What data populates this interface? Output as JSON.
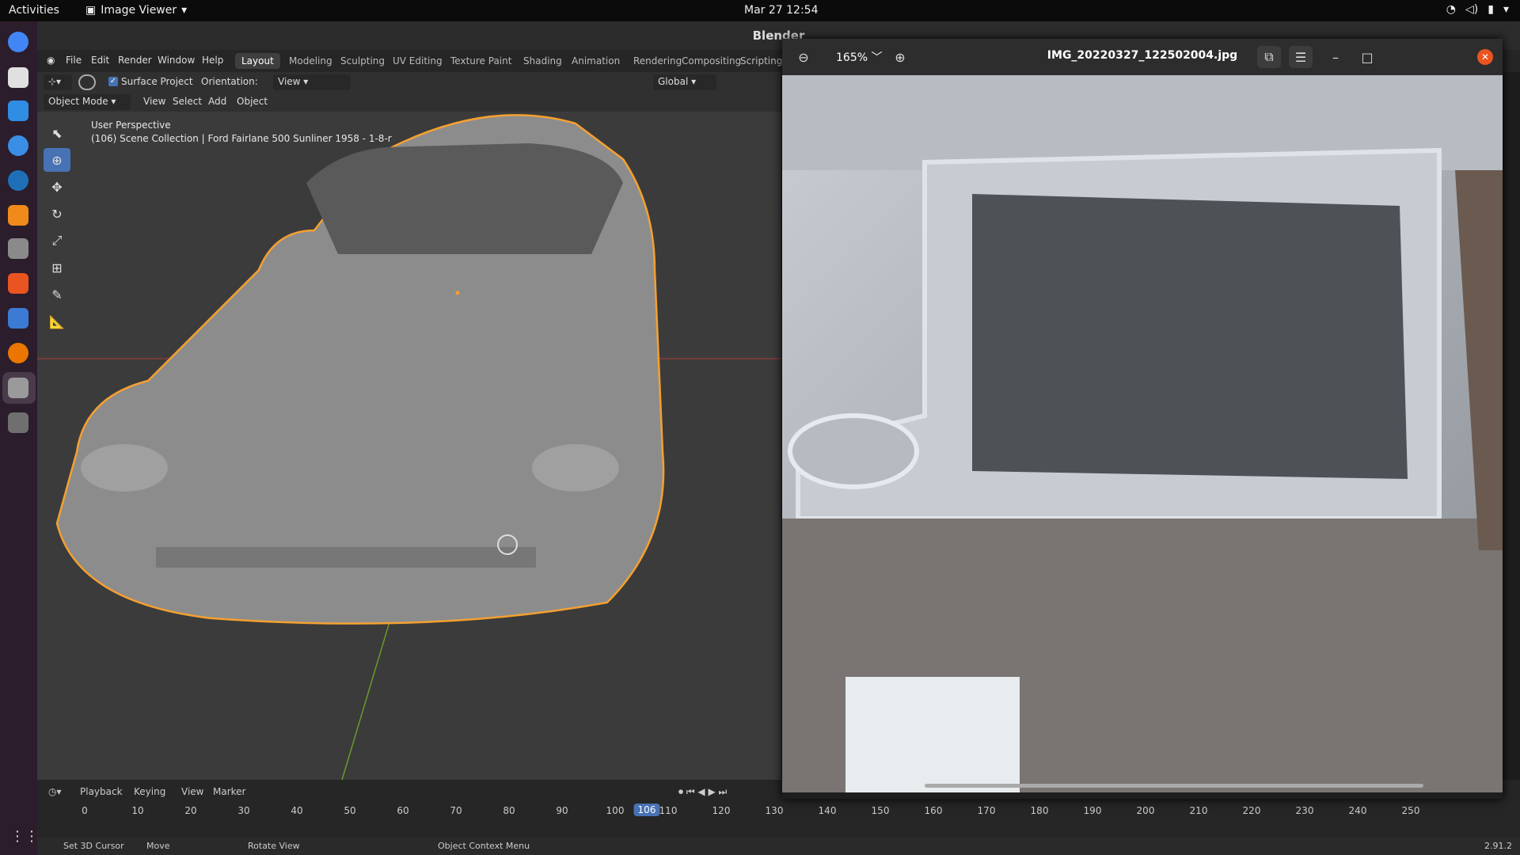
{
  "topbar": {
    "activities": "Activities",
    "app_name": "Image Viewer",
    "clock": "Mar 27  12:54"
  },
  "blender": {
    "window_title": "Blender",
    "menu": [
      "File",
      "Edit",
      "Render",
      "Window",
      "Help"
    ],
    "workspaces": [
      "Layout",
      "Modeling",
      "Sculpting",
      "UV Editing",
      "Texture Paint",
      "Shading",
      "Animation",
      "Rendering",
      "Compositing",
      "Scripting"
    ],
    "tool_header": {
      "surface_project": "Surface Project",
      "orientation_label": "Orientation:",
      "orientation_value": "View",
      "transform_orientation": "Global"
    },
    "mode_header": {
      "mode": "Object Mode",
      "view": "View",
      "select": "Select",
      "add": "Add",
      "object": "Object"
    },
    "viewport": {
      "perspective": "User Perspective",
      "collection": "(106) Scene Collection | Ford Fairlane 500 Sunliner 1958 - 1-8-r"
    },
    "timeline": {
      "menus": [
        "Playback",
        "Keying",
        "View",
        "Marker"
      ],
      "frames": [
        "0",
        "10",
        "20",
        "30",
        "40",
        "50",
        "60",
        "70",
        "80",
        "90",
        "100",
        "110",
        "120",
        "130",
        "140",
        "150",
        "160",
        "170",
        "180",
        "190",
        "200",
        "210",
        "220",
        "230",
        "240",
        "250"
      ],
      "current_frame": "106"
    },
    "status": {
      "set_cursor": "Set 3D Cursor",
      "move": "Move",
      "rotate": "Rotate View",
      "context": "Object Context Menu",
      "version": "2.91.2"
    }
  },
  "image_viewer": {
    "zoom": "165%",
    "filename": "IMG_20220327_122502004.jpg"
  },
  "colors": {
    "accent": "#4772b3",
    "selection_outline": "#f5a030",
    "ubuntu_orange": "#e95420"
  }
}
